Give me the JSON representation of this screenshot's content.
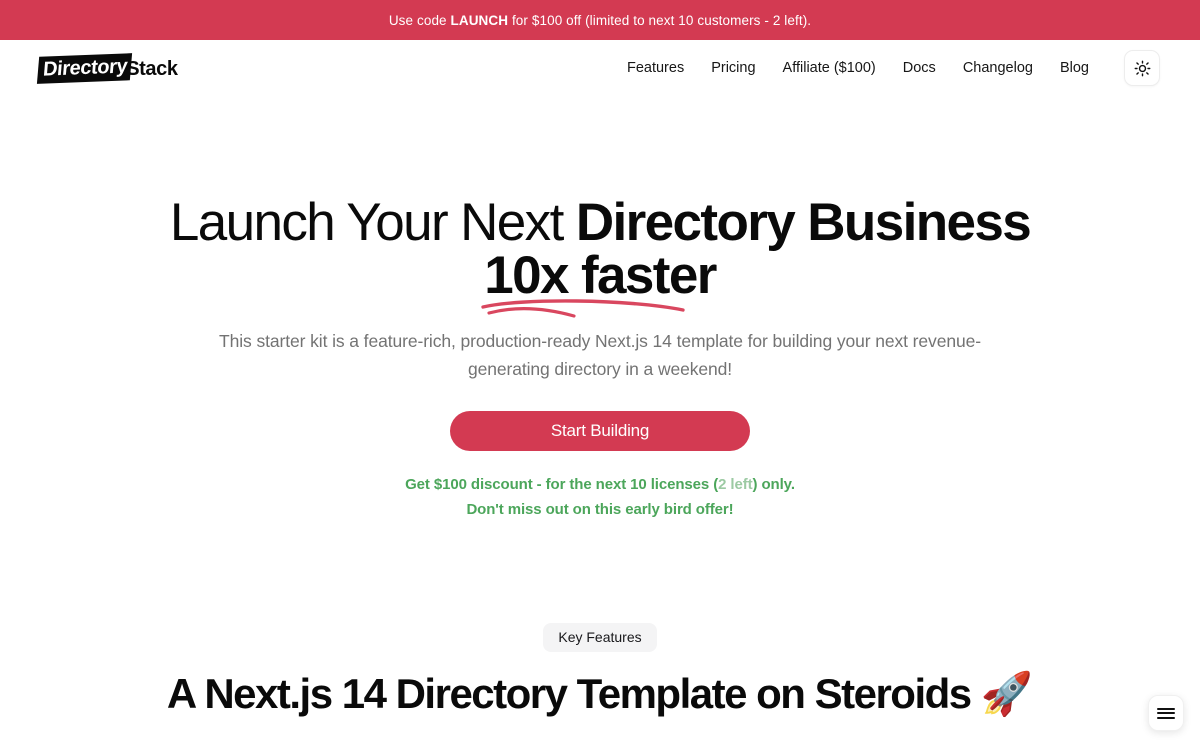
{
  "banner": {
    "prefix": "Use code ",
    "code": "LAUNCH",
    "suffix": " for $100 off (limited to next 10 customers - 2 left).",
    "background_color": "#d33a52",
    "text_color": "#ffffff"
  },
  "header": {
    "logo": {
      "mark_text": "Directory",
      "word_text": "Stack",
      "mark_bg": "#0a0a0a",
      "mark_color": "#ffffff",
      "word_color": "#0a0a0a"
    },
    "nav": [
      {
        "label": "Features"
      },
      {
        "label": "Pricing"
      },
      {
        "label": "Affiliate ($100)"
      },
      {
        "label": "Docs"
      },
      {
        "label": "Changelog"
      },
      {
        "label": "Blog"
      }
    ],
    "theme_toggle": {
      "icon": "sun-icon",
      "mode": "light"
    }
  },
  "hero": {
    "title_light": "Launch Your Next ",
    "title_bold_1": "Directory Business",
    "title_bold_2": "10x faster",
    "underline_color": "#d9475f",
    "subtitle": "This starter kit is a feature-rich, production-ready Next.js 14 template for building your next revenue-generating directory in a weekend!",
    "cta_label": "Start Building",
    "cta_color": "#d33a52",
    "discount_line_1_a": "Get $100 discount - for the next 10 licenses (",
    "discount_line_1_b": "2 left",
    "discount_line_1_c": ") only.",
    "discount_line_2": "Don't miss out on this early bird offer!",
    "discount_color": "#4ca65b",
    "discount_muted_color": "#9ccaa3"
  },
  "features": {
    "badge": "Key Features",
    "title": "A Next.js 14 Directory Template on Steroids ",
    "title_emoji": "🚀"
  },
  "floating_menu": {
    "icon": "hamburger-menu-icon"
  }
}
